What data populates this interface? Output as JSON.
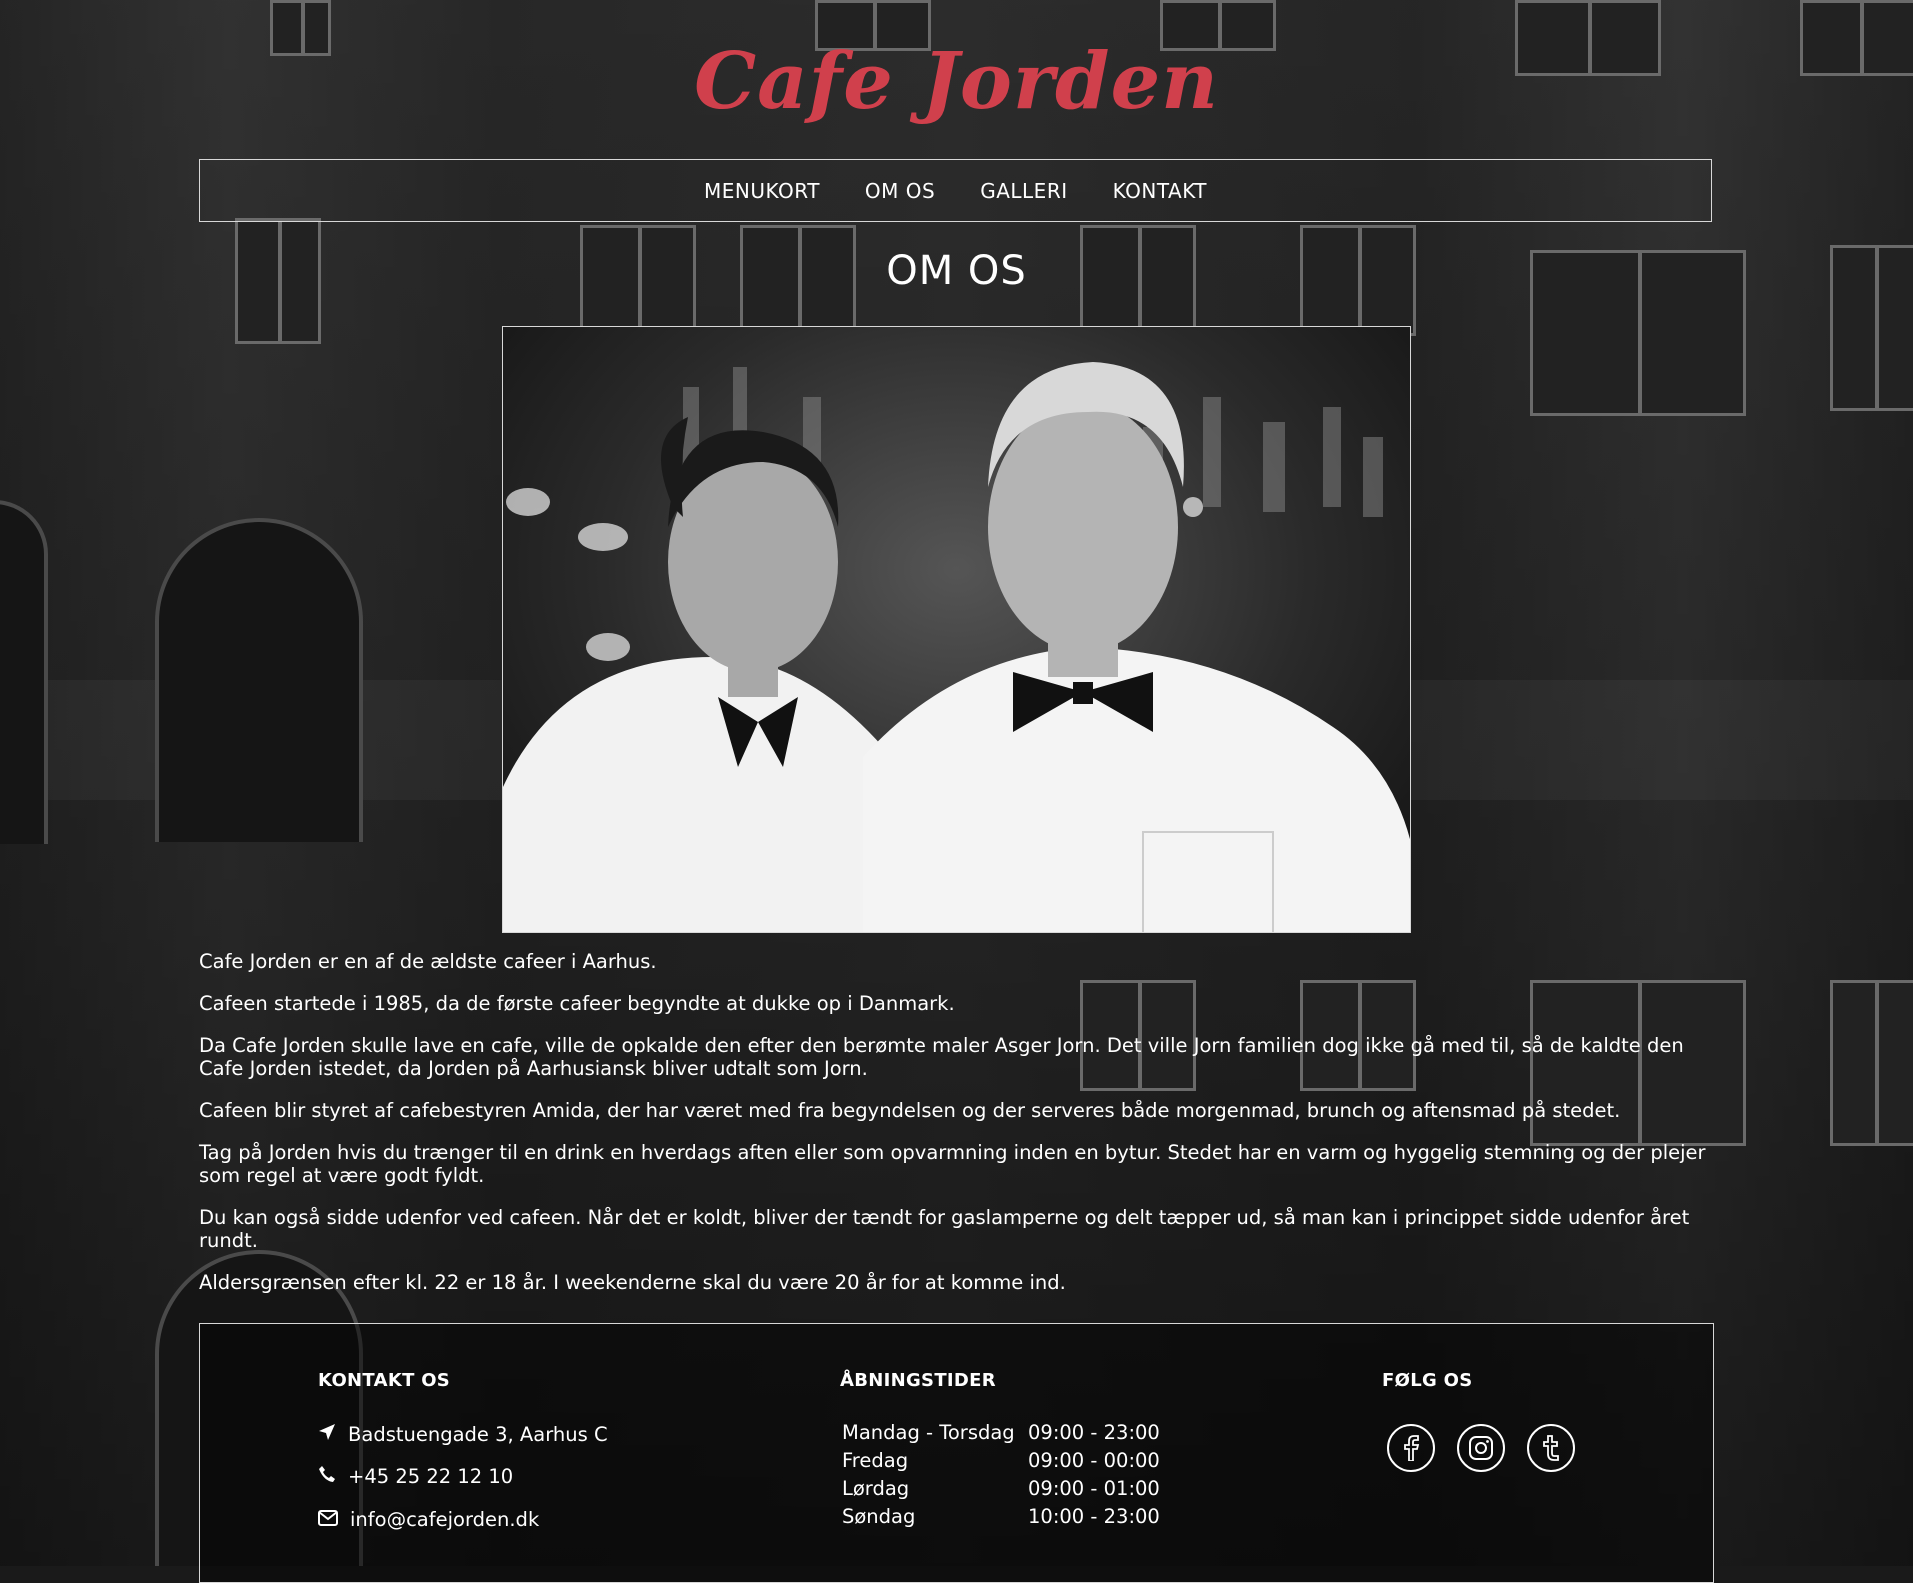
{
  "logo": "Cafe Jorden",
  "nav": {
    "items": [
      "MENUKORT",
      "OM OS",
      "GALLERI",
      "KONTAKT"
    ]
  },
  "page_title": "OM OS",
  "paragraphs": [
    "Cafe Jorden er en af de ældste cafeer i Aarhus.",
    "Cafeen startede i 1985, da de første cafeer begyndte at dukke op i Danmark.",
    "Da Cafe Jorden skulle lave en cafe, ville de opkalde den efter den berømte maler Asger Jorn. Det ville Jorn familien dog ikke gå med til, så de kaldte den Cafe Jorden istedet, da Jorden på Aarhusiansk bliver udtalt som Jorn.",
    "Cafeen blir styret af cafebestyren Amida, der har været med fra begyndelsen og der serveres både morgenmad, brunch og aftensmad på stedet.",
    "Tag på Jorden hvis du trænger til en drink en hverdags aften eller som opvarmning inden en bytur. Stedet har en varm og hyggelig stemning og der plejer som regel at være godt fyldt.",
    "Du kan også sidde udenfor ved cafeen. Når det er koldt, bliver der tændt for gaslamperne og delt tæpper ud, så man kan i princippet sidde udenfor året rundt.",
    "Aldersgrænsen efter kl. 22 er 18 år. I weekenderne skal du være 20 år for at komme ind."
  ],
  "footer": {
    "contact": {
      "title": "KONTAKT OS",
      "address": "Badstuengade 3, Aarhus C",
      "phone": "+45 25 22 12 10",
      "email": "info@cafejorden.dk",
      "icons": [
        "location-arrow-icon",
        "phone-icon",
        "envelope-icon"
      ]
    },
    "hours": {
      "title": "ÅBNINGSTIDER",
      "rows": [
        {
          "day": "Mandag - Torsdag",
          "time": "09:00 - 23:00"
        },
        {
          "day": "Fredag",
          "time": "09:00 - 00:00"
        },
        {
          "day": "Lørdag",
          "time": "09:00 - 01:00"
        },
        {
          "day": "Søndag",
          "time": "10:00 - 23:00"
        }
      ]
    },
    "social": {
      "title": "FØLG OS",
      "icons": [
        "facebook-icon",
        "instagram-icon",
        "tumblr-icon"
      ]
    }
  },
  "colors": {
    "logo": "#d0404c",
    "border": "#d8d8d8",
    "text": "#ffffff"
  }
}
